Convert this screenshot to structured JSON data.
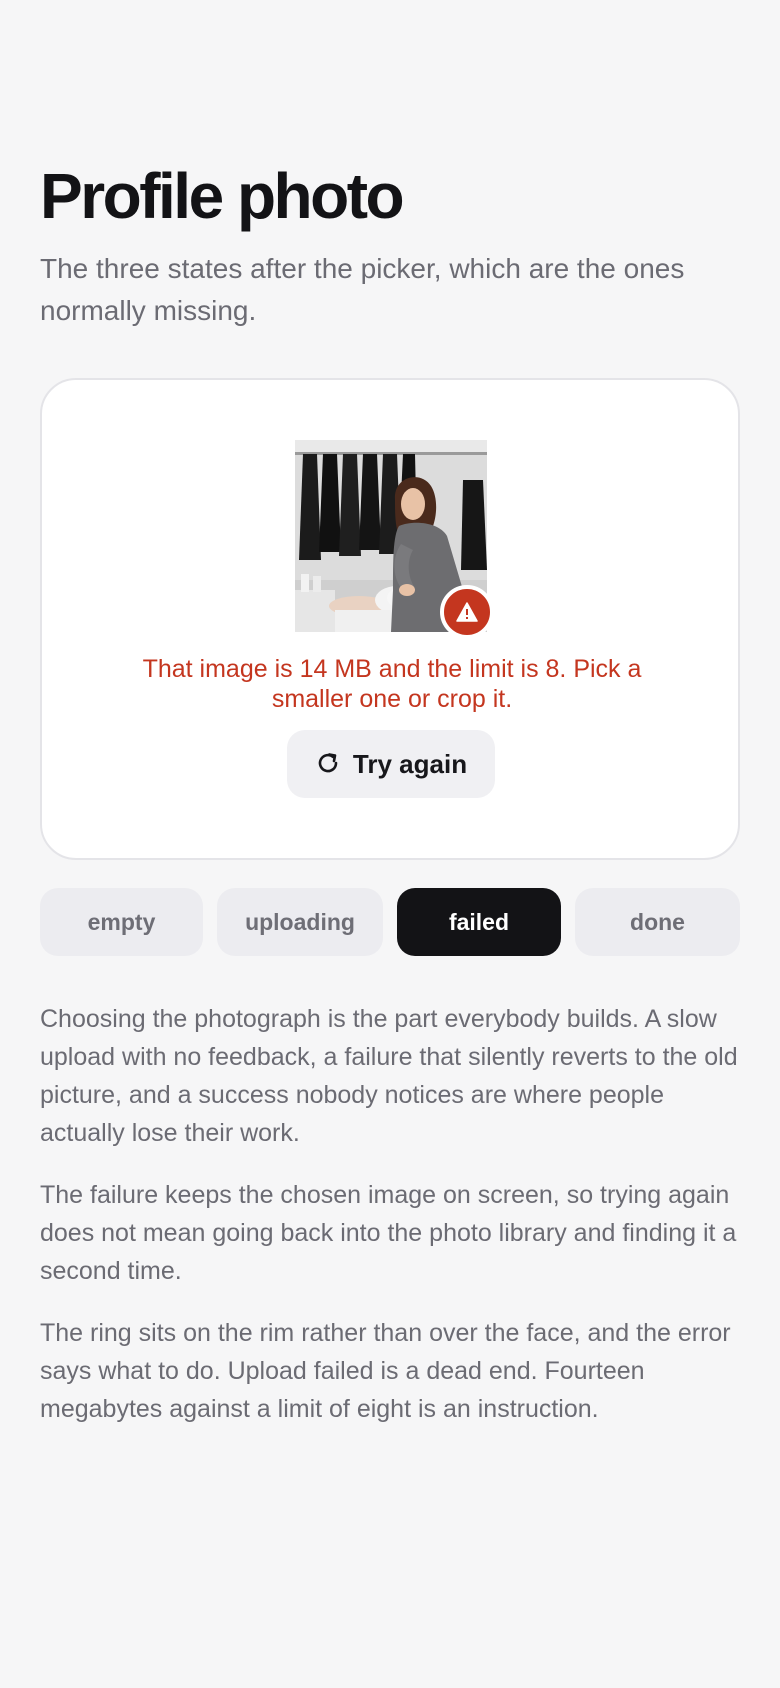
{
  "page": {
    "title": "Profile photo",
    "subtitle": "The three states after the picker, which are the ones normally missing."
  },
  "card": {
    "photo_icon": "avatar-photo",
    "badge_icon": "warning-icon",
    "error_message": "That image is 14 MB and the limit is 8. Pick a smaller one or crop it.",
    "retry_icon": "refresh-icon",
    "retry_label": "Try again"
  },
  "tabs": [
    {
      "label": "empty",
      "active": false
    },
    {
      "label": "uploading",
      "active": false
    },
    {
      "label": "failed",
      "active": true
    },
    {
      "label": "done",
      "active": false
    }
  ],
  "paragraphs": [
    "Choosing the photograph is the part everybody builds. A slow upload with no feedback, a failure that silently reverts to the old picture, and a success nobody notices are where people actually lose their work.",
    "The failure keeps the chosen image on screen, so trying again does not mean going back into the photo library and finding it a second time.",
    "The ring sits on the rim rather than over the face, and the error says what to do. Upload failed is a dead end. Fourteen megabytes against a limit of eight is an instruction."
  ],
  "colors": {
    "background": "#f6f6f7",
    "error": "#c4361f",
    "active_tab": "#131316",
    "title": "#131316"
  }
}
